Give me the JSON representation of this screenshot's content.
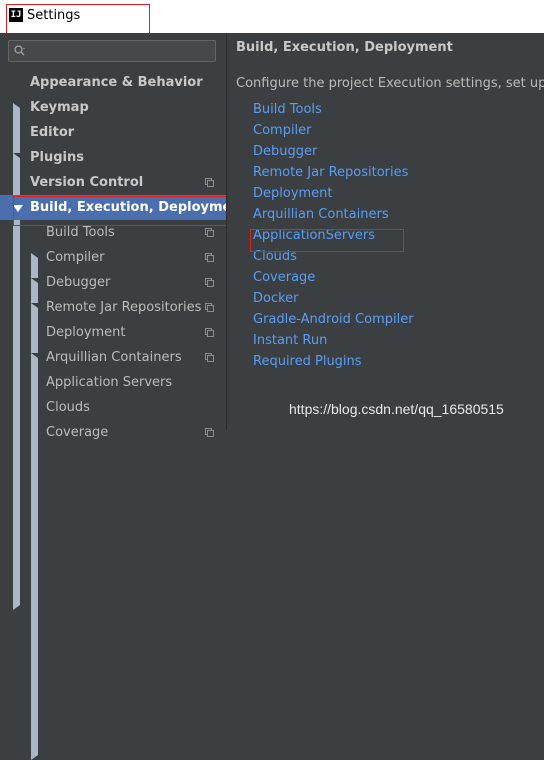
{
  "window": {
    "title": "Settings",
    "logo": "IJ"
  },
  "search": {
    "placeholder": ""
  },
  "tree": [
    {
      "label": "Appearance & Behavior",
      "bold": true,
      "arrow": "right",
      "copy": false
    },
    {
      "label": "Keymap",
      "bold": true,
      "arrow": "none",
      "copy": false
    },
    {
      "label": "Editor",
      "bold": true,
      "arrow": "right",
      "copy": false
    },
    {
      "label": "Plugins",
      "bold": true,
      "arrow": "none",
      "copy": false
    },
    {
      "label": "Version Control",
      "bold": true,
      "arrow": "right",
      "copy": true
    },
    {
      "label": "Build, Execution, Deployment",
      "bold": true,
      "arrow": "down",
      "copy": false,
      "selected": true
    },
    {
      "label": "Build Tools",
      "bold": false,
      "arrow": "right",
      "copy": true
    },
    {
      "label": "Compiler",
      "bold": false,
      "arrow": "right",
      "copy": true
    },
    {
      "label": "Debugger",
      "bold": false,
      "arrow": "right",
      "copy": true
    },
    {
      "label": "Remote Jar Repositories",
      "bold": false,
      "arrow": "none",
      "copy": true
    },
    {
      "label": "Deployment",
      "bold": false,
      "arrow": "right",
      "copy": true
    },
    {
      "label": "Arquillian Containers",
      "bold": false,
      "arrow": "none",
      "copy": true
    },
    {
      "label": "Application Servers",
      "bold": false,
      "arrow": "none",
      "copy": false
    },
    {
      "label": "Clouds",
      "bold": false,
      "arrow": "none",
      "copy": false
    },
    {
      "label": "Coverage",
      "bold": false,
      "arrow": "none",
      "copy": true
    }
  ],
  "panel": {
    "title": "Build, Execution, Deployment",
    "description": "Configure the project Execution settings, set up Deplo",
    "links": [
      "Build Tools",
      "Compiler",
      "Debugger",
      "Remote Jar Repositories",
      "Deployment",
      "Arquillian Containers",
      "ApplicationServers",
      "Clouds",
      "Coverage",
      "Docker",
      "Gradle-Android Compiler",
      "Instant Run",
      "Required Plugins"
    ]
  },
  "watermark": "https://blog.csdn.net/qq_16580515",
  "colors": {
    "background": "#3c3f41",
    "selection": "#4b6eaf",
    "link": "#589df6",
    "highlight": "#e0201c"
  }
}
